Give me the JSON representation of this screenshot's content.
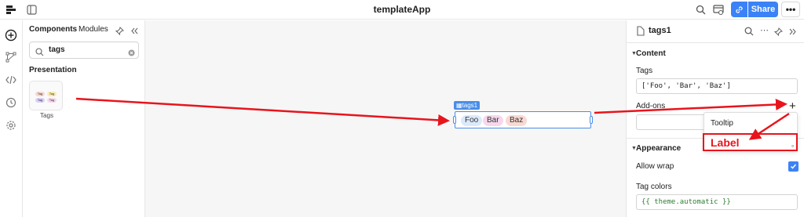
{
  "app": {
    "title": "templateApp"
  },
  "toolbar": {
    "share_label": "Share",
    "more_label": "•••"
  },
  "panel": {
    "tabs": [
      "Components",
      "Modules"
    ],
    "search_value": "tags",
    "section": "Presentation",
    "tile_label": "Tags",
    "mini_tag": "Tag"
  },
  "canvas": {
    "component_name": "tags1",
    "tags": [
      {
        "label": "Foo",
        "color": "#dbe9fb"
      },
      {
        "label": "Bar",
        "color": "#f6d7ec"
      },
      {
        "label": "Baz",
        "color": "#f9d9d2"
      }
    ]
  },
  "inspector": {
    "title": "tags1",
    "content_header": "Content",
    "tags_label": "Tags",
    "tags_value": "['Foo', 'Bar', 'Baz']",
    "addons_label": "Add-ons",
    "appearance_header": "Appearance",
    "allow_wrap_label": "Allow wrap",
    "allow_wrap_checked": true,
    "tag_colors_label": "Tag colors",
    "tag_colors_value": "{{ theme.automatic }}"
  },
  "dropdown": {
    "items": [
      "Tooltip",
      "Label"
    ]
  },
  "colors": {
    "accent": "#3b82f6",
    "annotation": "#e8141c"
  }
}
